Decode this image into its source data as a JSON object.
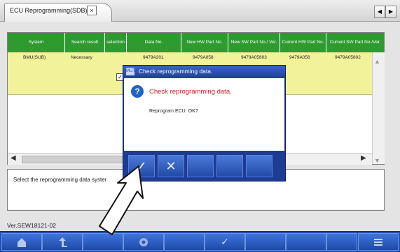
{
  "tab": {
    "label": "ECU Reprogramming(SDB)",
    "close_glyph": "×"
  },
  "nav": {
    "prev": "◀",
    "next": "▶"
  },
  "table": {
    "headers": [
      "System",
      "Search result",
      "selection",
      "Data No.",
      "New HW Part No.",
      "New SW Part No./ Ver.",
      "Current HW Part No.",
      "Current SW Part No./Ver."
    ],
    "rows": [
      {
        "system": "BMU(SUB)",
        "search_result": "Necessary",
        "selection": "✓",
        "data_no": "9479A201",
        "new_hw": "9479A058",
        "new_sw": "9479A05803",
        "cur_hw": "9479A058",
        "cur_sw": "9479A05802"
      }
    ]
  },
  "message": {
    "text": "Select the reprogramming data syster"
  },
  "version": "Ver.SEW18121-02",
  "dialog": {
    "title": "Check reprogramming data.",
    "heading": "Check reprogramming data.",
    "message": "Reprogram ECU. OK?",
    "ok_glyph": "✓",
    "cancel_glyph": "✕"
  },
  "bottom_toolbar": {
    "icons": [
      "home-icon",
      "back-icon",
      "blank",
      "gear-icon",
      "blank",
      "check-icon",
      "blank",
      "blank",
      "blank",
      "list-icon"
    ],
    "check_glyph": "✓"
  },
  "colors": {
    "header_green": "#2f9a2f",
    "row_yellow": "#f2f29a",
    "toolbar_blue": "#1f4fb8",
    "alert_red": "#d41e1e"
  }
}
